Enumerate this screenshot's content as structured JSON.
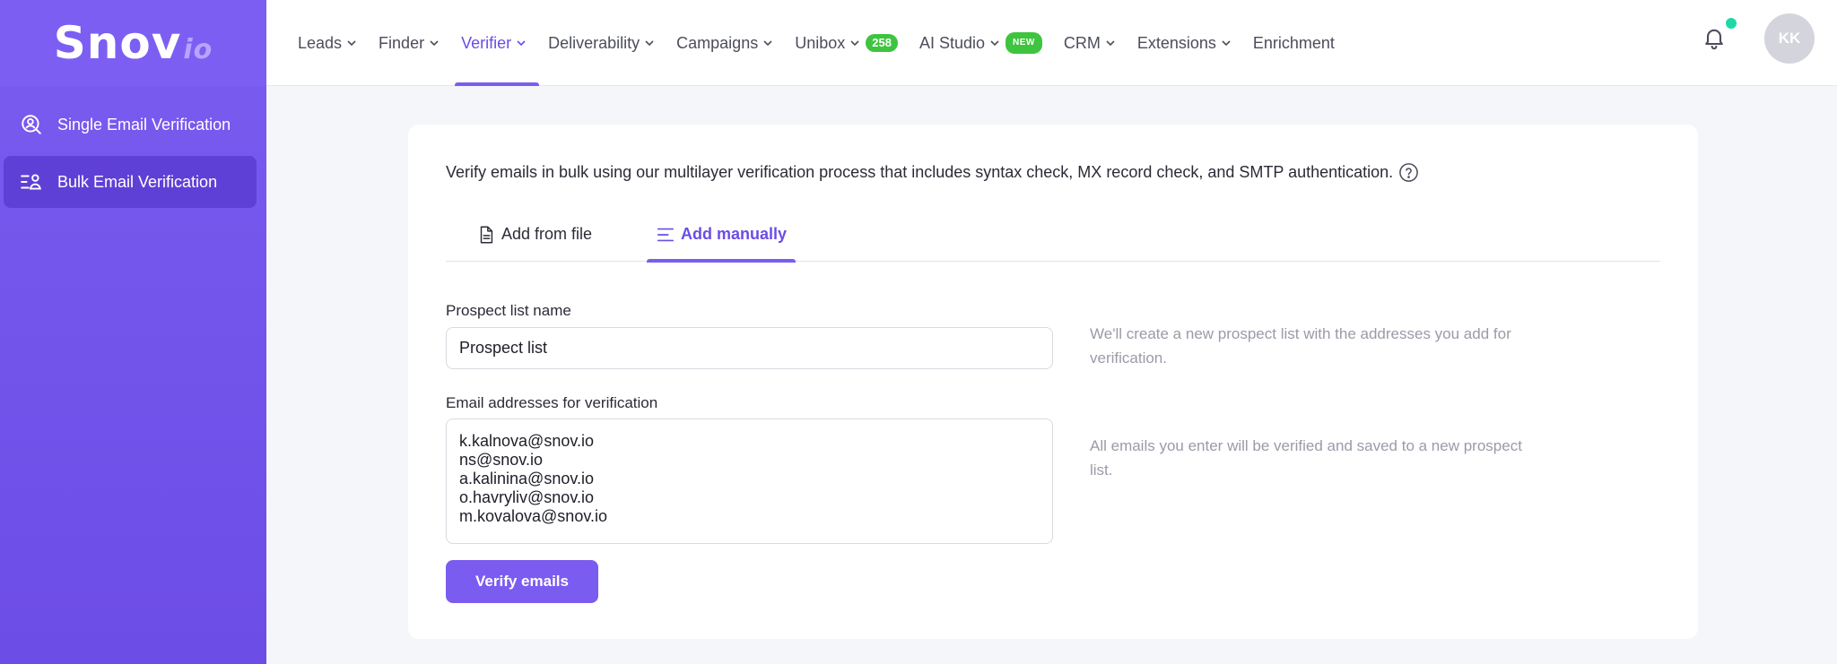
{
  "logo": {
    "main": "Snov",
    "suffix": "io"
  },
  "sidebar": {
    "items": [
      {
        "label": "Single Email Verification",
        "icon": "user-search-icon"
      },
      {
        "label": "Bulk Email Verification",
        "icon": "users-list-icon",
        "active": true
      }
    ]
  },
  "nav": {
    "items": [
      {
        "label": "Leads"
      },
      {
        "label": "Finder"
      },
      {
        "label": "Verifier",
        "active": true
      },
      {
        "label": "Deliverability"
      },
      {
        "label": "Campaigns"
      },
      {
        "label": "Unibox",
        "badge": "258"
      },
      {
        "label": "AI Studio",
        "badge": "NEW"
      },
      {
        "label": "CRM"
      },
      {
        "label": "Extensions"
      },
      {
        "label": "Enrichment"
      }
    ]
  },
  "user": {
    "initials": "KK"
  },
  "main": {
    "description": "Verify emails in bulk using our multilayer verification process that includes syntax check, MX record check, and SMTP authentication.",
    "tabs": [
      {
        "label": "Add from file",
        "icon": "file-icon"
      },
      {
        "label": "Add manually",
        "icon": "lines-icon",
        "active": true
      }
    ],
    "list_name_label": "Prospect list name",
    "list_name_value": "Prospect list",
    "list_name_hint": "We'll create a new prospect list with the addresses you add for verification.",
    "emails_label": "Email addresses for verification",
    "emails_value": "k.kalnova@snov.io\nns@snov.io\na.kalinina@snov.io\no.havryliv@snov.io\nm.kovalova@snov.io",
    "emails_hint": "All emails you enter will be verified and saved to a new prospect list.",
    "verify_button": "Verify emails"
  },
  "colors": {
    "accent": "#7b5cf0",
    "badge": "#3ec43e",
    "notify": "#1ed9a5"
  }
}
